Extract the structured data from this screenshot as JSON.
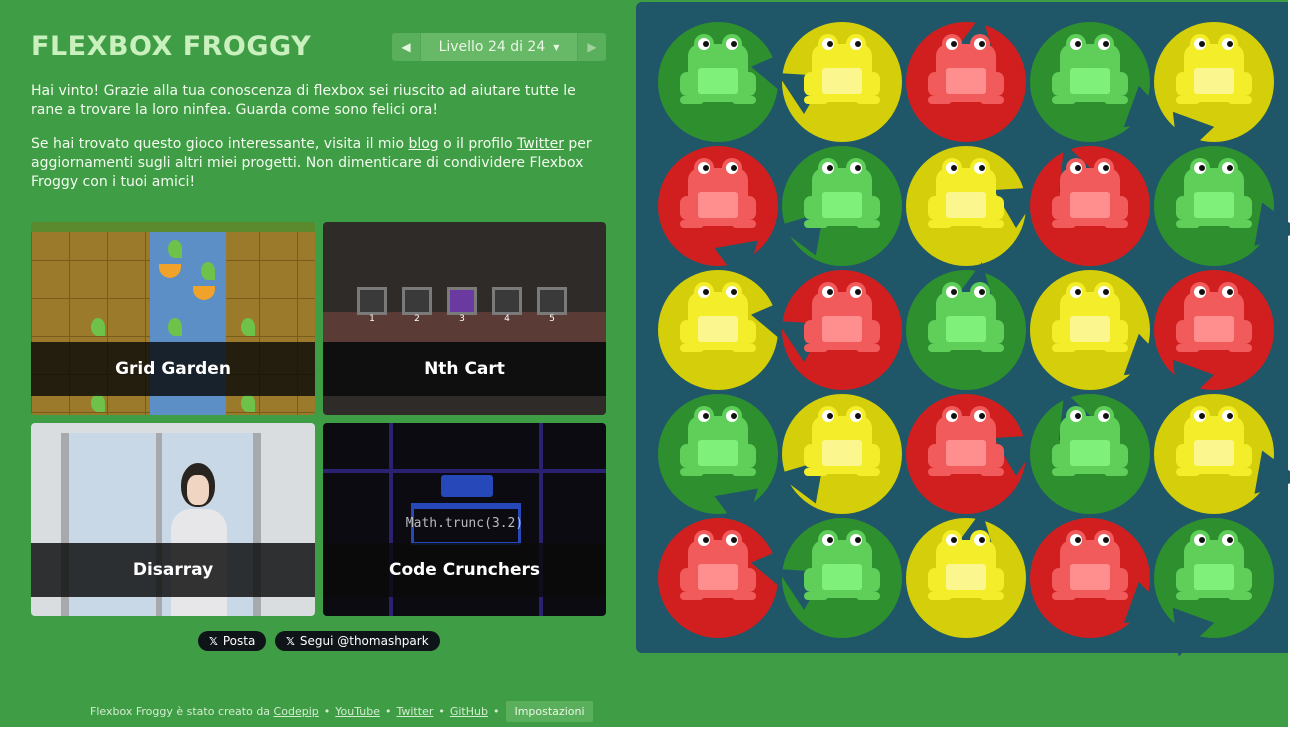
{
  "header": {
    "title": "FLEXBOX FROGGY",
    "level_label": "Livello 24 di 24",
    "prev_icon": "triangle-left",
    "next_icon": "triangle-right",
    "dropdown_icon": "caret-down"
  },
  "instructions": {
    "p1": "Hai vinto! Grazie alla tua conoscenza di flexbox sei riuscito ad aiutare tutte le rane a trovare la loro ninfea. Guarda come sono felici ora!",
    "p2_pre": "Se hai trovato questo gioco interessante, visita il mio ",
    "p2_link1": "blog",
    "p2_mid": " o il profilo ",
    "p2_link2": "Twitter",
    "p2_post": " per aggiornamenti sugli altri miei progetti. Non dimenticare di condividere Flexbox Froggy con i tuoi amici!"
  },
  "games": [
    {
      "name": "Grid Garden"
    },
    {
      "name": "Nth Cart",
      "cart_numbers": [
        "1",
        "2",
        "3",
        "4",
        "5"
      ]
    },
    {
      "name": "Disarray"
    },
    {
      "name": "Code Crunchers",
      "code": "Math.trunc(3.2)"
    }
  ],
  "social": {
    "post": "Posta",
    "follow": "Segui @thomashpark",
    "icon": "x-logo"
  },
  "footer": {
    "credit": "Flexbox Froggy è stato creato da",
    "links": [
      "Codepip",
      "YouTube",
      "Twitter",
      "GitHub"
    ],
    "separator": "•",
    "settings": "Impostazioni"
  },
  "colors": {
    "background": "#3f9e45",
    "board": "#1f5768",
    "title": "#c9f0bd",
    "green_pad": "#2e8f2e",
    "green_frog": "#5fcf5a",
    "green_belly": "#7ff07a",
    "yellow_pad": "#d4cf0a",
    "yellow_frog": "#f4ee2a",
    "yellow_belly": "#fbf78e",
    "red_pad": "#d11f1f",
    "red_frog": "#f25b5b",
    "red_belly": "#ff8f8f"
  },
  "board": {
    "rows": [
      [
        "green",
        "yellow",
        "red",
        "green",
        "yellow"
      ],
      [
        "red",
        "green",
        "yellow",
        "red",
        "green"
      ],
      [
        "yellow",
        "red",
        "green",
        "yellow",
        "red"
      ],
      [
        "green",
        "yellow",
        "red",
        "green",
        "yellow"
      ],
      [
        "red",
        "green",
        "yellow",
        "red",
        "green"
      ]
    ]
  }
}
